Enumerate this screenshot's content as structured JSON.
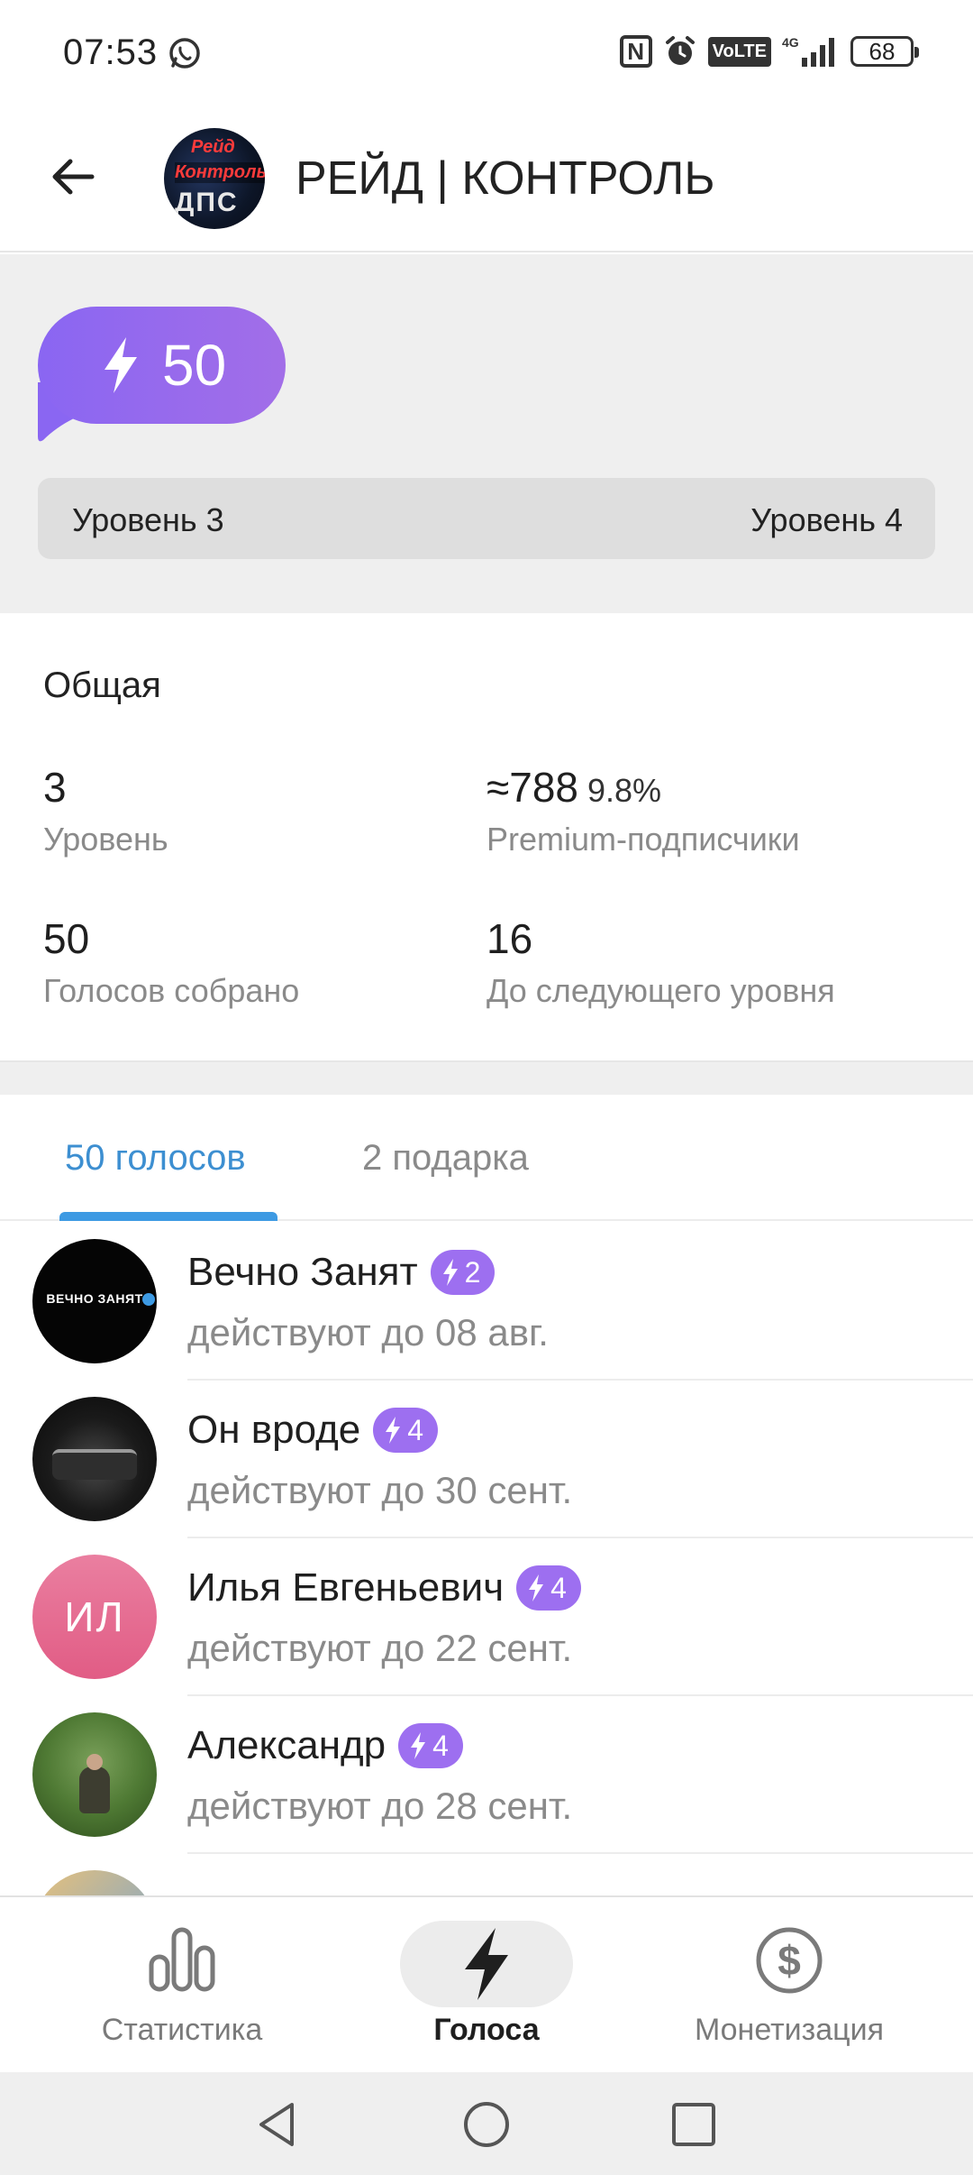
{
  "status_bar": {
    "time": "07:53",
    "battery": "68",
    "volte": "VoLTE",
    "icons": [
      "whatsapp-icon",
      "nfc-icon",
      "alarm-icon",
      "volte-icon",
      "signal-4g-icon",
      "battery-icon"
    ]
  },
  "header": {
    "title": "РЕЙД | КОНТРОЛЬ",
    "avatar_text": [
      "Рейд",
      "Контроль",
      "ДПС"
    ]
  },
  "boost": {
    "count": "50",
    "current_level": "Уровень 3",
    "next_level": "Уровень 4",
    "accent": "#9a6cf0"
  },
  "overview": {
    "title": "Общая",
    "stats": [
      {
        "value": "3",
        "extra": "",
        "label": "Уровень"
      },
      {
        "value": "≈788",
        "extra": "9.8%",
        "label": "Premium-подписчики"
      },
      {
        "value": "50",
        "extra": "",
        "label": "Голосов собрано"
      },
      {
        "value": "16",
        "extra": "",
        "label": "До следующего уровня"
      }
    ]
  },
  "tabs": {
    "active": "50 голосов",
    "inactive": "2 подарка",
    "active_color": "#3d8fd1"
  },
  "boosters": [
    {
      "name": "Вечно Занят",
      "boosts": "2",
      "expires": "действуют до 08 авг.",
      "avatar_text": "ВЕЧНО ЗАНЯТ"
    },
    {
      "name": "Он вроде",
      "boosts": "4",
      "expires": "действуют до 30 сент.",
      "avatar_text": ""
    },
    {
      "name": "Илья Евгеньевич",
      "boosts": "4",
      "expires": "действуют до 22 сент.",
      "avatar_text": "ИЛ"
    },
    {
      "name": "Александр",
      "boosts": "4",
      "expires": "действуют до 28 сент.",
      "avatar_text": ""
    }
  ],
  "bottom_nav": {
    "stats": "Статистика",
    "votes": "Голоса",
    "monetization": "Монетизация"
  }
}
